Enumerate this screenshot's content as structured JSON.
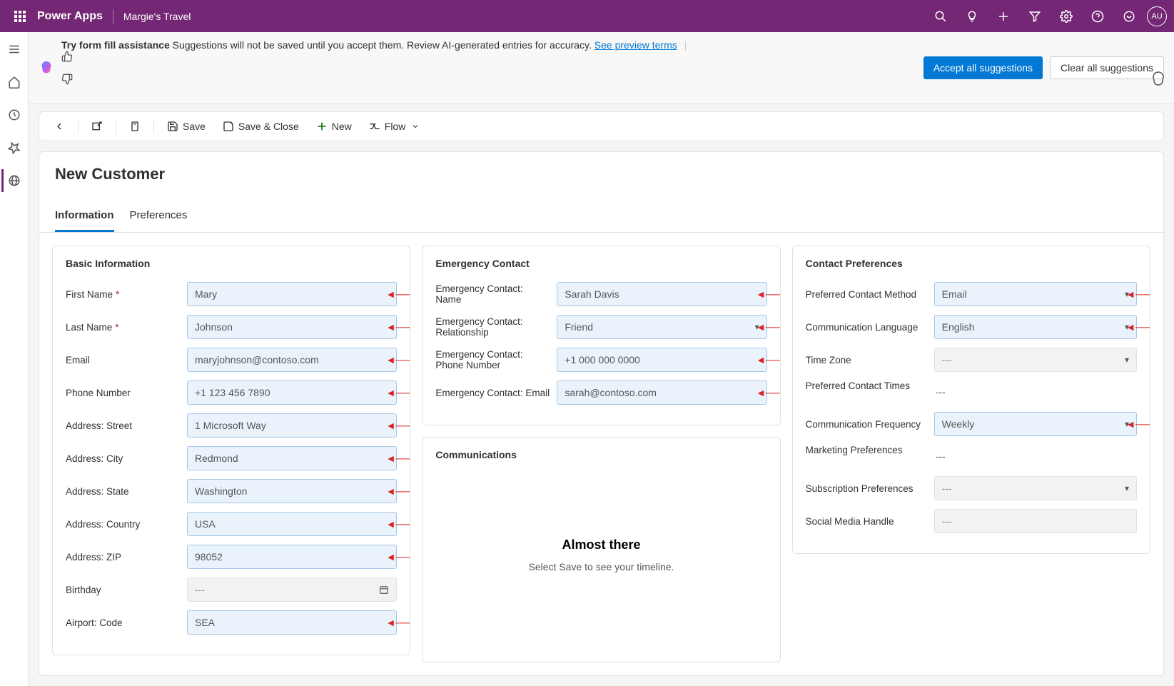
{
  "topbar": {
    "brand": "Power Apps",
    "app": "Margie's Travel",
    "avatar": "AU"
  },
  "banner": {
    "bold": "Try form fill assistance",
    "text": " Suggestions will not be saved until you accept them. Review AI-generated entries for accuracy. ",
    "link": "See preview terms",
    "accept": "Accept all suggestions",
    "clear": "Clear all suggestions"
  },
  "commands": {
    "save": "Save",
    "saveClose": "Save & Close",
    "new": "New",
    "flow": "Flow"
  },
  "page": {
    "title": "New Customer",
    "tabs": {
      "info": "Information",
      "prefs": "Preferences"
    }
  },
  "sections": {
    "basic": "Basic Information",
    "emergency": "Emergency Contact",
    "comms": "Communications",
    "contactPrefs": "Contact Preferences"
  },
  "basic": {
    "firstName": {
      "label": "First Name",
      "value": "Mary"
    },
    "lastName": {
      "label": "Last Name",
      "value": "Johnson"
    },
    "email": {
      "label": "Email",
      "value": "maryjohnson@contoso.com"
    },
    "phone": {
      "label": "Phone Number",
      "value": "+1 123 456 7890"
    },
    "street": {
      "label": "Address: Street",
      "value": "1 Microsoft Way"
    },
    "city": {
      "label": "Address: City",
      "value": "Redmond"
    },
    "state": {
      "label": "Address: State",
      "value": "Washington"
    },
    "country": {
      "label": "Address: Country",
      "value": "USA"
    },
    "zip": {
      "label": "Address: ZIP",
      "value": "98052"
    },
    "birthday": {
      "label": "Birthday",
      "value": "---"
    },
    "airport": {
      "label": "Airport: Code",
      "value": "SEA"
    }
  },
  "emergency": {
    "name": {
      "label": "Emergency Contact: Name",
      "value": "Sarah Davis"
    },
    "rel": {
      "label": "Emergency Contact: Relationship",
      "value": "Friend"
    },
    "phone": {
      "label": "Emergency Contact: Phone Number",
      "value": "+1 000 000 0000"
    },
    "email": {
      "label": "Emergency Contact: Email",
      "value": "sarah@contoso.com"
    }
  },
  "timeline": {
    "title": "Almost there",
    "sub": "Select Save to see your timeline."
  },
  "prefs": {
    "method": {
      "label": "Preferred Contact Method",
      "value": "Email"
    },
    "lang": {
      "label": "Communication Language",
      "value": "English"
    },
    "tz": {
      "label": "Time Zone",
      "value": "---"
    },
    "times": {
      "label": "Preferred Contact Times",
      "value": "---"
    },
    "freq": {
      "label": "Communication Frequency",
      "value": "Weekly"
    },
    "marketing": {
      "label": "Marketing Preferences",
      "value": "---"
    },
    "subs": {
      "label": "Subscription Preferences",
      "value": "---"
    },
    "social": {
      "label": "Social Media Handle",
      "value": "---"
    }
  }
}
